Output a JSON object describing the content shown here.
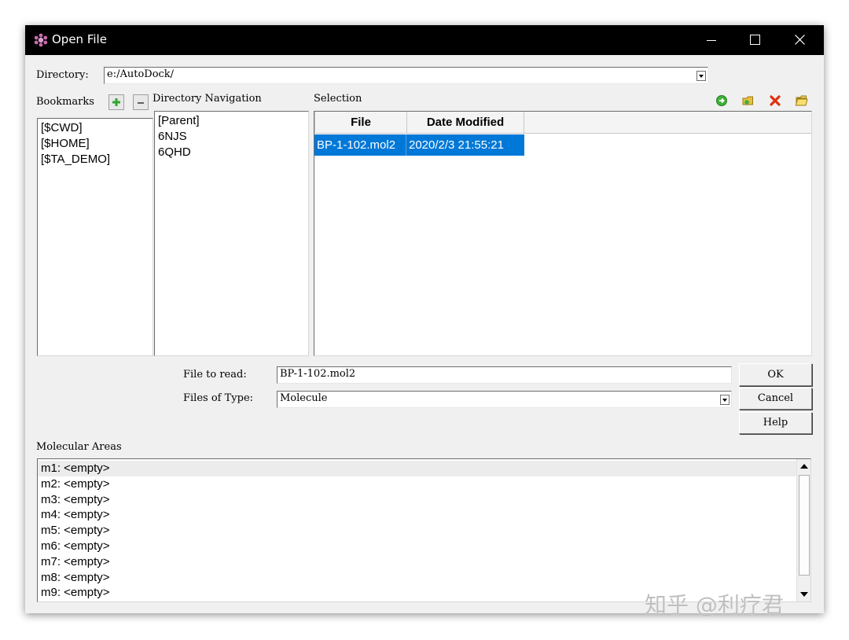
{
  "window": {
    "title": "Open File"
  },
  "directory": {
    "label": "Directory:",
    "value": "e:/AutoDock/"
  },
  "toolbar_icons": [
    "go-icon",
    "new-folder-icon",
    "delete-icon",
    "open-folder-icon"
  ],
  "bookmarks": {
    "label": "Bookmarks",
    "items": [
      "[$CWD]",
      "[$HOME]",
      "[$TA_DEMO]"
    ]
  },
  "navigation": {
    "label": "Directory Navigation",
    "items": [
      "[Parent]",
      "6NJS",
      "6QHD"
    ]
  },
  "selection": {
    "label": "Selection",
    "columns": [
      "File",
      "Date Modified"
    ],
    "rows": [
      {
        "file": "BP-1-102.mol2",
        "date": "2020/2/3 21:55:21"
      }
    ]
  },
  "file_to_read": {
    "label": "File to read:",
    "value": "BP-1-102.mol2"
  },
  "files_of_type": {
    "label": "Files of Type:",
    "value": "Molecule"
  },
  "buttons": {
    "ok": "OK",
    "cancel": "Cancel",
    "help": "Help"
  },
  "molecular_areas": {
    "label": "Molecular Areas",
    "items": [
      "m1: <empty>",
      "m2: <empty>",
      "m3: <empty>",
      "m4: <empty>",
      "m5: <empty>",
      "m6: <empty>",
      "m7: <empty>",
      "m8: <empty>",
      "m9: <empty>"
    ]
  },
  "watermark": "知乎 @利疗君",
  "colors": {
    "selection_highlight": "#0078d7",
    "titlebar": "#000000"
  }
}
